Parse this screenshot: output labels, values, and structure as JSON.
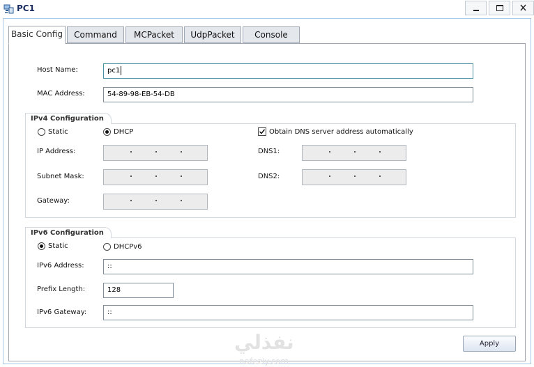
{
  "window": {
    "title": "PC1",
    "controls": {
      "minimize": "minimize-icon",
      "maximize": "maximize-icon",
      "close": "close-icon"
    }
  },
  "tabs": [
    {
      "label": "Basic Config",
      "active": true
    },
    {
      "label": "Command",
      "active": false
    },
    {
      "label": "MCPacket",
      "active": false
    },
    {
      "label": "UdpPacket",
      "active": false
    },
    {
      "label": "Console",
      "active": false
    }
  ],
  "basic": {
    "host_name": {
      "label": "Host Name:",
      "value": "pc1"
    },
    "mac_address": {
      "label": "MAC Address:",
      "value": "54-89-98-EB-54-DB"
    }
  },
  "ipv4": {
    "group_title": "IPv4 Configuration",
    "mode_static": "Static",
    "mode_dhcp": "DHCP",
    "selected_mode": "DHCP",
    "ip_address_label": "IP Address:",
    "subnet_mask_label": "Subnet Mask:",
    "gateway_label": "Gateway:",
    "obtain_dns_label": "Obtain DNS server address automatically",
    "obtain_dns_checked": true,
    "dns1_label": "DNS1:",
    "dns2_label": "DNS2:",
    "ip_fields_enabled": false
  },
  "ipv6": {
    "group_title": "IPv6 Configuration",
    "mode_static": "Static",
    "mode_dhcp": "DHCPv6",
    "selected_mode": "Static",
    "address": {
      "label": "IPv6 Address:",
      "value": "::"
    },
    "prefix_length": {
      "label": "Prefix Length:",
      "value": "128"
    },
    "gateway": {
      "label": "IPv6 Gateway:",
      "value": "::"
    }
  },
  "actions": {
    "apply_label": "Apply"
  },
  "watermark": {
    "arabic": "نفذلي",
    "latin": "nafezly.com"
  },
  "colors": {
    "title": "#1a2b5f",
    "frame_border": "#a9c7e8",
    "focus_border": "#4d8fa3",
    "disabled_field": "#ececec"
  }
}
